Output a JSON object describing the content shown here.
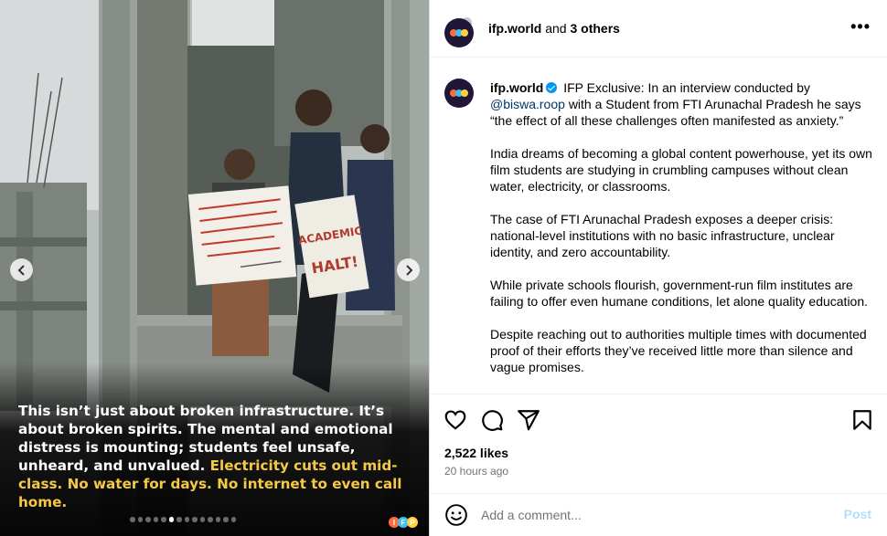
{
  "media": {
    "caption_white": "This isn’t just about broken infrastructure. It’s about broken spirits. The mental and emotional distress is mounting; students feel unsafe, unheard, and unvalued.",
    "caption_yellow": "Electricity cuts out mid-class. No water for days. No internet to even call home.",
    "caption_color": "#f6c945",
    "placard_right_text": "ACADEMIC HALT!",
    "slide_count": 14,
    "active_slide_index": 5,
    "prev_icon": "chevron-left-icon",
    "next_icon": "chevron-right-icon"
  },
  "header": {
    "account": "ifp.world",
    "joiner": "and",
    "others": "3 others",
    "more_icon": "more-options-icon"
  },
  "post": {
    "username": "ifp.world",
    "verified_icon": "verified-badge-icon",
    "intro_1": "IFP Exclusive: In an interview conducted by",
    "mention": "@biswa.roop",
    "intro_2": "with a Student from FTI Arunachal Pradesh he says “the effect of all these challenges often manifested as anxiety.”",
    "paragraphs": [
      "India dreams of becoming a global content powerhouse, yet its own film students are studying in crumbling campuses without clean water, electricity, or classrooms.",
      "The case of FTI Arunachal Pradesh exposes a deeper crisis: national-level institutions with no basic infrastructure, unclear identity, and zero accountability.",
      "While private schools flourish, government-run film institutes are failing to offer even humane conditions, let alone quality education.",
      "Despite reaching out to authorities multiple times with documented proof of their efforts they’ve received little more than silence and vague promises."
    ]
  },
  "actions": {
    "likes": "2,522 likes",
    "time": "20 hours ago"
  },
  "comment_box": {
    "placeholder": "Add a comment...",
    "post_label": "Post"
  },
  "colors": {
    "link": "#00376b",
    "verified": "#0095f6",
    "post_disabled": "#b2dffc",
    "brand_dots": [
      "#ff6b3d",
      "#3ec1f0",
      "#ffd23f"
    ]
  }
}
